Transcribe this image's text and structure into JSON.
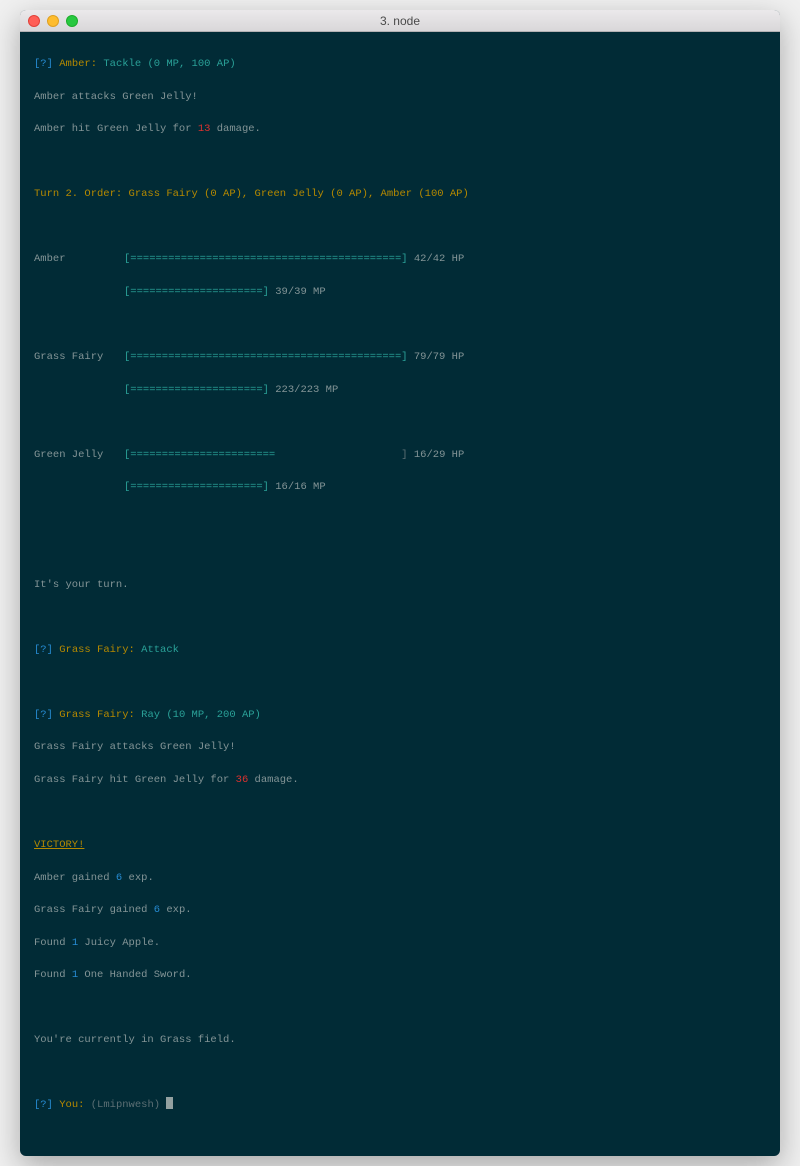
{
  "window": {
    "title": "3. node"
  },
  "log": {
    "amber_action_prompt": {
      "prefix": "[?] ",
      "name": "Amber",
      "sep": ": ",
      "move": "Tackle (0 MP, 100 AP)"
    },
    "amber_attack1": "Amber attacks Green Jelly!",
    "amber_attack2_a": "Amber hit Green Jelly for ",
    "amber_attack2_dmg": "13",
    "amber_attack2_b": " damage."
  },
  "turn_line": "Turn 2. Order: Grass Fairy (0 AP), Green Jelly (0 AP), Amber (100 AP)",
  "status": [
    {
      "name": "Amber",
      "hp_bar": "[===========================================]",
      "hp_text": " 42/42 HP",
      "mp_bar": "[=====================]",
      "mp_text": " 39/39 MP"
    },
    {
      "name": "Grass Fairy",
      "hp_bar": "[===========================================]",
      "hp_text": " 79/79 HP",
      "mp_bar": "[=====================]",
      "mp_text": " 223/223 MP"
    },
    {
      "name": "Green Jelly",
      "hp_bar_fill": "[=======================",
      "hp_bar_pad": "                    ]",
      "hp_text": " 16/29 HP",
      "mp_bar": "[=====================]",
      "mp_text": " 16/16 MP"
    }
  ],
  "your_turn": "It's your turn.",
  "gf_action": {
    "prefix": "[?] ",
    "name": "Grass Fairy",
    "sep": ": ",
    "choice": "Attack"
  },
  "gf_move": {
    "prefix": "[?] ",
    "name": "Grass Fairy",
    "sep": ": ",
    "move": "Ray (10 MP, 200 AP)"
  },
  "gf_attack1": "Grass Fairy attacks Green Jelly!",
  "gf_attack2_a": "Grass Fairy hit Green Jelly for ",
  "gf_attack2_dmg": "36",
  "gf_attack2_b": " damage.",
  "victory": "VICTORY!",
  "rewards": {
    "r1a": "Amber gained ",
    "r1n": "6",
    "r1b": " exp.",
    "r2a": "Grass Fairy gained ",
    "r2n": "6",
    "r2b": " exp.",
    "r3a": "Found ",
    "r3n": "1",
    "r3b": " Juicy Apple.",
    "r4a": "Found ",
    "r4n": "1",
    "r4b": " One Handed Sword."
  },
  "location": "You're currently in Grass field.",
  "prompt": {
    "prefix": "[?] ",
    "name": "You",
    "sep": ": ",
    "hint": "(Lmipnwesh) "
  }
}
